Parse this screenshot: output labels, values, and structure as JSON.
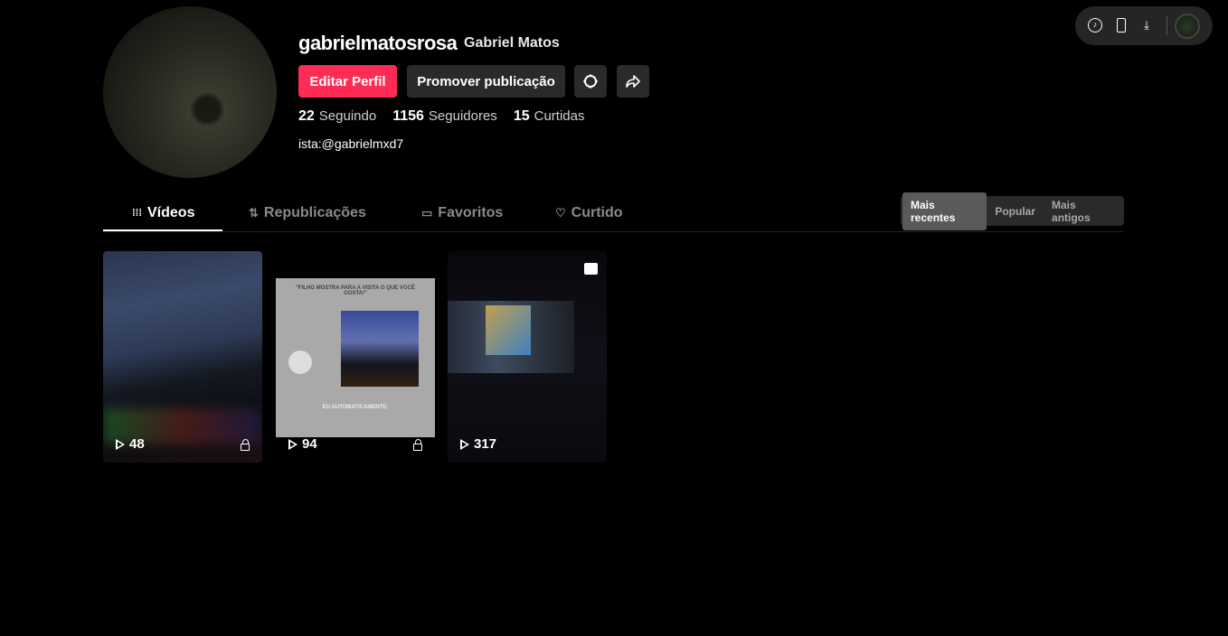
{
  "profile": {
    "username": "gabrielmatosrosa",
    "nickname": "Gabriel Matos",
    "bio": "ista:@gabrielmxd7",
    "stats": [
      {
        "value": "22",
        "label": "Seguindo"
      },
      {
        "value": "1156",
        "label": "Seguidores"
      },
      {
        "value": "15",
        "label": "Curtidas"
      }
    ]
  },
  "buttons": {
    "edit": "Editar Perfil",
    "promote": "Promover publicação"
  },
  "tabs": [
    {
      "label": "Vídeos"
    },
    {
      "label": "Republicações"
    },
    {
      "label": "Favoritos"
    },
    {
      "label": "Curtido"
    }
  ],
  "sort": [
    "Mais recentes",
    "Popular",
    "Mais antigos"
  ],
  "videos": [
    {
      "views": "48",
      "private": true
    },
    {
      "views": "94",
      "private": true,
      "caption_top": "\"FILHO MOSTRA PARA A VISITA O QUE VOCÊ GOSTA!\"",
      "caption_bottom": "EU AUTOMATICAMENTE:"
    },
    {
      "views": "317",
      "private": false
    }
  ],
  "colors": {
    "accent": "#fe2c55"
  }
}
